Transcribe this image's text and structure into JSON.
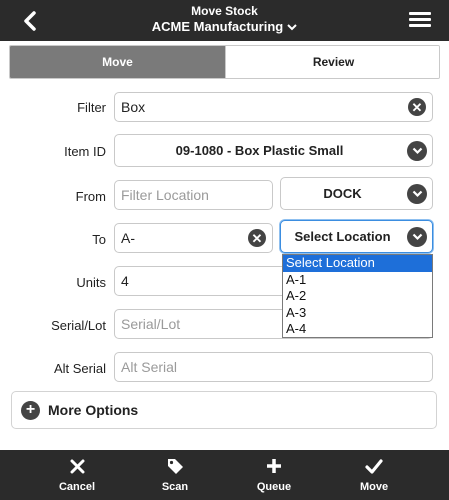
{
  "header": {
    "title": "Move Stock",
    "subtitle": "ACME Manufacturing",
    "back_icon": "chevron-left-icon",
    "menu_icon": "hamburger-menu-icon"
  },
  "tabs": [
    {
      "label": "Move",
      "active": true
    },
    {
      "label": "Review",
      "active": false
    }
  ],
  "form": {
    "filter": {
      "label": "Filter",
      "value": "Box"
    },
    "item_id": {
      "label": "Item ID",
      "value": "09-1080 - Box Plastic Small"
    },
    "from": {
      "label": "From",
      "placeholder": "Filter Location",
      "select_value": "DOCK"
    },
    "to": {
      "label": "To",
      "value": "A-",
      "select_value": "Select Location"
    },
    "units": {
      "label": "Units",
      "value": "4"
    },
    "serial_lot": {
      "label": "Serial/Lot",
      "placeholder": "Serial/Lot"
    },
    "alt_serial": {
      "label": "Alt Serial",
      "placeholder": "Alt Serial"
    }
  },
  "to_dropdown": {
    "options": [
      "Select Location",
      "A-1",
      "A-2",
      "A-3",
      "A-4"
    ],
    "selected": "Select Location"
  },
  "more_options": {
    "label": "More Options"
  },
  "footer": [
    {
      "label": "Cancel",
      "icon": "close-icon"
    },
    {
      "label": "Scan",
      "icon": "tag-icon"
    },
    {
      "label": "Queue",
      "icon": "plus-icon"
    },
    {
      "label": "Move",
      "icon": "checkmark-icon"
    }
  ],
  "colors": {
    "header_bg": "#2b2b2b",
    "active_tab": "#7a7a7a",
    "dropdown_selected": "#1e6fd9",
    "focus_border": "#3b8de0"
  }
}
